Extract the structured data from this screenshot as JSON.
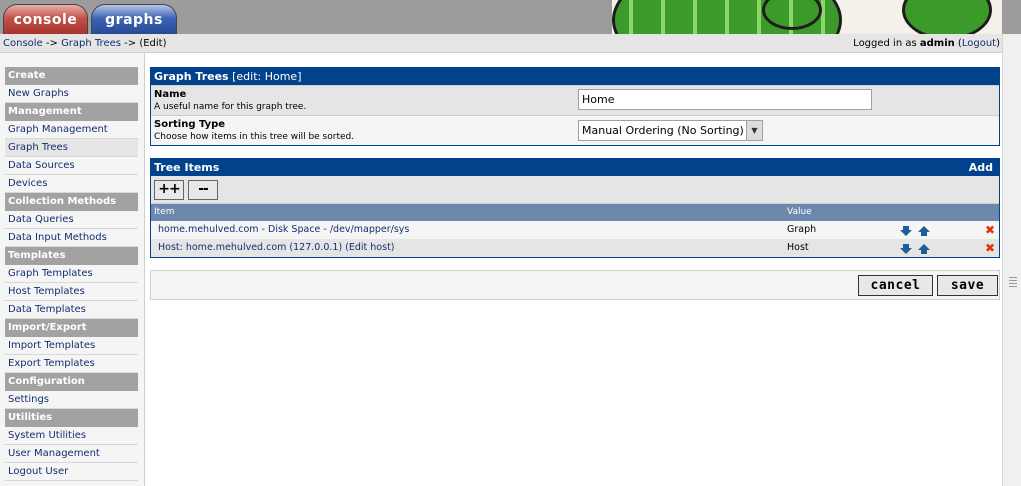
{
  "tabs": [
    "console",
    "graphs"
  ],
  "breadcrumb": {
    "console": "Console",
    "sep1": " -> ",
    "graph_trees": "Graph Trees",
    "sep2": " -> ",
    "current": "(Edit)"
  },
  "login": {
    "prefix": "Logged in as ",
    "user": "admin",
    "logout_open": " (",
    "logout": "Logout",
    "logout_close": ")"
  },
  "sidebar": [
    {
      "type": "head",
      "label": "Create"
    },
    {
      "type": "item",
      "label": "New Graphs"
    },
    {
      "type": "head",
      "label": "Management"
    },
    {
      "type": "item",
      "label": "Graph Management"
    },
    {
      "type": "item",
      "label": "Graph Trees",
      "selected": true
    },
    {
      "type": "item",
      "label": "Data Sources"
    },
    {
      "type": "item",
      "label": "Devices"
    },
    {
      "type": "head",
      "label": "Collection Methods"
    },
    {
      "type": "item",
      "label": "Data Queries"
    },
    {
      "type": "item",
      "label": "Data Input Methods"
    },
    {
      "type": "head",
      "label": "Templates"
    },
    {
      "type": "item",
      "label": "Graph Templates"
    },
    {
      "type": "item",
      "label": "Host Templates"
    },
    {
      "type": "item",
      "label": "Data Templates"
    },
    {
      "type": "head",
      "label": "Import/Export"
    },
    {
      "type": "item",
      "label": "Import Templates"
    },
    {
      "type": "item",
      "label": "Export Templates"
    },
    {
      "type": "head",
      "label": "Configuration"
    },
    {
      "type": "item",
      "label": "Settings"
    },
    {
      "type": "head",
      "label": "Utilities"
    },
    {
      "type": "item",
      "label": "System Utilities"
    },
    {
      "type": "item",
      "label": "User Management"
    },
    {
      "type": "item",
      "label": "Logout User"
    }
  ],
  "edit_panel": {
    "title": "Graph Trees",
    "subtitle": " [edit: Home]",
    "name_label": "Name",
    "name_desc": "A useful name for this graph tree.",
    "name_value": "Home",
    "sort_label": "Sorting Type",
    "sort_desc": "Choose how items in this tree will be sorted.",
    "sort_value": "Manual Ordering (No Sorting)"
  },
  "tree_panel": {
    "title": "Tree Items",
    "add": "Add",
    "expand_btn": "++",
    "collapse_btn": "--",
    "col_item": "Item",
    "col_value": "Value",
    "rows": [
      {
        "item": "home.mehulved.com - Disk Space - /dev/mapper/sys",
        "value": "Graph"
      },
      {
        "item": "Host: home.mehulved.com (127.0.0.1) (Edit host)",
        "value": "Host"
      }
    ]
  },
  "actions": {
    "cancel": "cancel",
    "save": "save"
  },
  "colors": {
    "panel_header": "#00438c",
    "table_header": "#6d88ad",
    "menu_head": "#a2a2a2",
    "link": "#122f6e",
    "delete": "#e4320e",
    "arrow": "#1e5d9a"
  },
  "icons": {
    "move_down": "arrow-down-icon",
    "move_up": "arrow-up-icon",
    "delete": "delete-x-icon"
  }
}
